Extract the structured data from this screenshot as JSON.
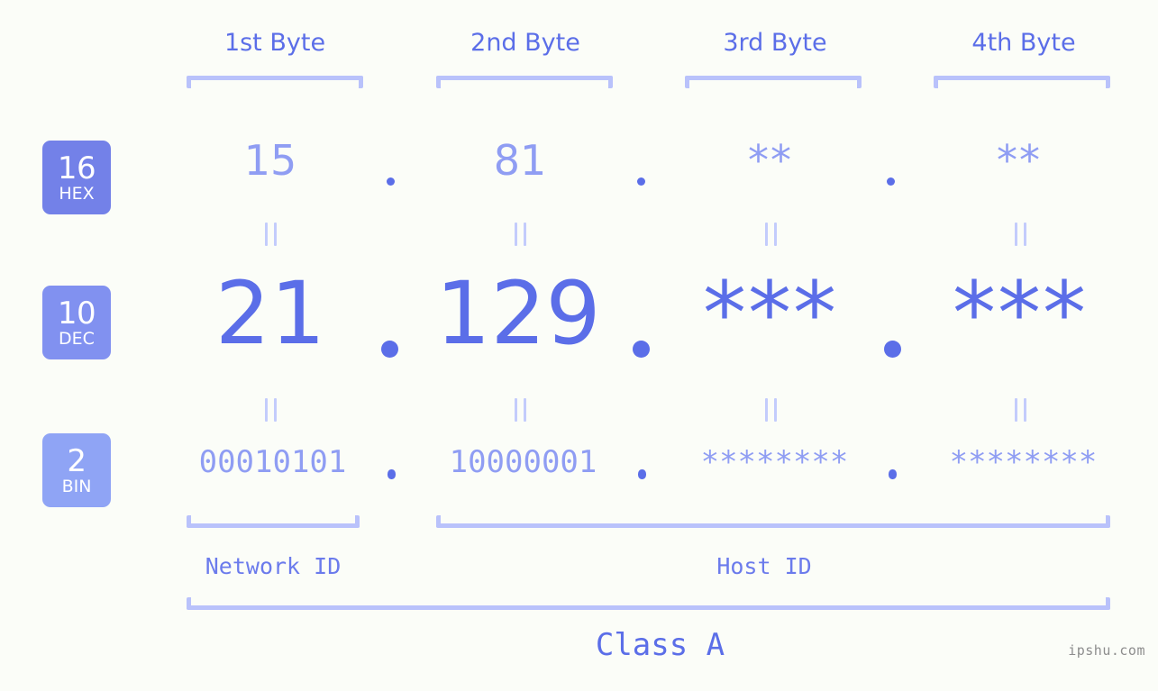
{
  "byte_headers": [
    {
      "label": "1st Byte"
    },
    {
      "label": "2nd Byte"
    },
    {
      "label": "3rd Byte"
    },
    {
      "label": "4th Byte"
    }
  ],
  "radix_rows": [
    {
      "base": "16",
      "abbr": "HEX",
      "badge_color": "#7381e8",
      "value_color": "#8f9df3",
      "values": [
        "15",
        "81",
        "**",
        "**"
      ]
    },
    {
      "base": "10",
      "abbr": "DEC",
      "badge_color": "#8191f0",
      "value_color": "#5b6ee8",
      "values": [
        "21",
        "129",
        "***",
        "***"
      ]
    },
    {
      "base": "2",
      "abbr": "BIN",
      "badge_color": "#8fa4f5",
      "value_color": "#8f9df3",
      "values": [
        "00010101",
        "10000001",
        "********",
        "********"
      ]
    }
  ],
  "separator": ".",
  "equality_mark": "=",
  "segments": {
    "network_id": "Network ID",
    "host_id": "Host ID"
  },
  "class_label": "Class A",
  "watermark": "ipshu.com",
  "colors": {
    "background": "#fbfdf8",
    "accent_strong": "#5b6ee8",
    "accent_light": "#8f9df3",
    "bracket": "#b9c2fb",
    "equals": "#c3ccfc",
    "watermark": "#8d8d8d"
  }
}
